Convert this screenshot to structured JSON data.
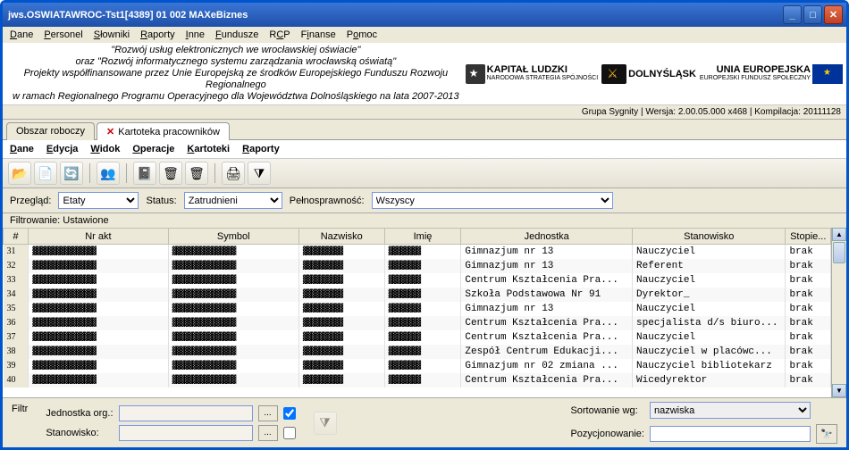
{
  "window": {
    "title": "jws.OSWIATAWROC-Tst1[4389] 01 002 MAXeBiznes"
  },
  "menu": [
    "Dane",
    "Personel",
    "Słowniki",
    "Raporty",
    "Inne",
    "Fundusze",
    "RCP",
    "Finanse",
    "Pomoc"
  ],
  "banner": {
    "l1": "\"Rozwój usług elektronicznych we wrocławskiej oświacie\"",
    "l2": "oraz \"Rozwój informatycznego systemu zarządzania wrocławską oświatą\"",
    "l3": "Projekty współfinansowane przez Unie Europejską ze środków Europejskiego Funduszu Rozwoju Regionalnego",
    "l4": "w ramach Regionalnego Programu Operacyjnego dla Województwa Dolnośląskiego na lata 2007-2013",
    "logo1": "KAPITAŁ LUDZKI",
    "logo1s": "NARODOWA STRATEGIA SPÓJNOŚCI",
    "logo2a": "DOLNY",
    "logo2b": "ŚLĄSK",
    "logo3": "UNIA EUROPEJSKA",
    "logo3s": "EUROPEJSKI FUNDUSZ SPOŁECZNY"
  },
  "status": "Grupa Sygnity | Wersja: 2.00.05.000 x468 | Kompilacja: 20111128",
  "tabs": {
    "t1": "Obszar roboczy",
    "t2": "Kartoteka pracowników"
  },
  "submenu": [
    "Dane",
    "Edycja",
    "Widok",
    "Operacje",
    "Kartoteki",
    "Raporty"
  ],
  "filters": {
    "przeglad_lbl": "Przegląd:",
    "przeglad_val": "Etaty",
    "status_lbl": "Status:",
    "status_val": "Zatrudnieni",
    "pelno_lbl": "Pełnosprawność:",
    "pelno_val": "Wszyscy"
  },
  "filtr_status": "Filtrowanie: Ustawione",
  "columns": [
    "#",
    "Nr akt",
    "Symbol",
    "Nazwisko",
    "Imię",
    "Jednostka",
    "Stanowisko",
    "Stopie..."
  ],
  "rows": [
    {
      "idx": "31",
      "jednostka": "Gimnazjum nr 13",
      "stanowisko": "Nauczyciel",
      "stopien": "brak"
    },
    {
      "idx": "32",
      "jednostka": "Gimnazjum nr 13",
      "stanowisko": "Referent",
      "stopien": "brak"
    },
    {
      "idx": "33",
      "jednostka": "Centrum Kształcenia Pra...",
      "stanowisko": "Nauczyciel",
      "stopien": "brak"
    },
    {
      "idx": "34",
      "jednostka": "Szkoła Podstawowa Nr 91",
      "stanowisko": "Dyrektor_",
      "stopien": "brak"
    },
    {
      "idx": "35",
      "jednostka": "Gimnazjum nr 13",
      "stanowisko": "Nauczyciel",
      "stopien": "brak"
    },
    {
      "idx": "36",
      "jednostka": "Centrum Kształcenia Pra...",
      "stanowisko": "specjalista d/s biuro...",
      "stopien": "brak"
    },
    {
      "idx": "37",
      "jednostka": "Centrum Kształcenia Pra...",
      "stanowisko": "Nauczyciel",
      "stopien": "brak"
    },
    {
      "idx": "38",
      "jednostka": "Zespół Centrum Edukacji...",
      "stanowisko": "Nauczyciel w placówc...",
      "stopien": "brak"
    },
    {
      "idx": "39",
      "jednostka": "Gimnazjum nr 02 zmiana ...",
      "stanowisko": "Nauczyciel bibliotekarz",
      "stopien": "brak"
    },
    {
      "idx": "40",
      "jednostka": "Centrum Kształcenia Pra...",
      "stanowisko": "Wicedyrektor",
      "stopien": "brak"
    }
  ],
  "footer": {
    "filtr": "Filtr",
    "jednostka": "Jednostka org.:",
    "stanowisko": "Stanowisko:",
    "sort_lbl": "Sortowanie wg:",
    "sort_val": "nazwiska",
    "pozyc": "Pozycjonowanie:"
  }
}
